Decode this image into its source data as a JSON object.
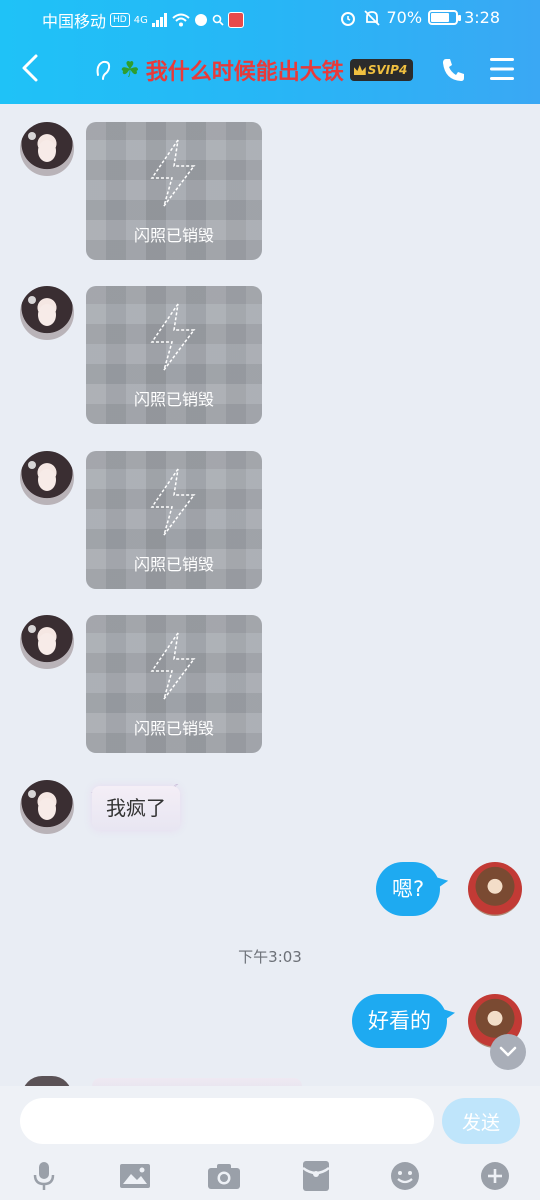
{
  "status_bar": {
    "carrier": "中国移动",
    "hd": "HD",
    "network": "4G",
    "battery": "70%",
    "battery_level": 0.7,
    "time": "3:28"
  },
  "header": {
    "title": "我什么时候能出大铁",
    "badge": "SVIP4"
  },
  "messages": {
    "flash_1": "闪照已销毁",
    "flash_2": "闪照已销毁",
    "flash_3": "闪照已销毁",
    "flash_4": "闪照已销毁",
    "text_her": "我疯了",
    "me_1": "嗯?",
    "time_separator": "下午3:03",
    "me_2": "好看的"
  },
  "input": {
    "value": "",
    "send_label": "发送"
  },
  "colors": {
    "header_start": "#1fc2f7",
    "bubble_me": "#1eaaf1",
    "title_text": "#e83a3a",
    "background": "#e9edf4"
  },
  "toolbar_icons": [
    "mic-icon",
    "image-icon",
    "camera-icon",
    "red-packet-icon",
    "emoji-icon",
    "plus-icon"
  ]
}
